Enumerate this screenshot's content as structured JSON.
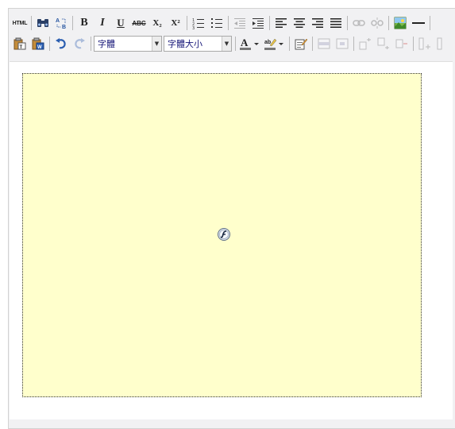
{
  "toolbar": {
    "html_label": "HTML",
    "bold_label": "B",
    "italic_label": "I",
    "underline_label": "U",
    "strike_label": "ABC",
    "subscript_label": "X₂",
    "superscript_label": "X²",
    "font_family": {
      "selected": "字體"
    },
    "font_size": {
      "selected": "字體大小"
    }
  },
  "colors": {
    "flash_placeholder_bg": "#ffffcc",
    "toolbar_bg": "#f1f1f3",
    "link_blue": "#1a1a7a"
  },
  "content": {
    "embedded_object": "flash-placeholder"
  }
}
